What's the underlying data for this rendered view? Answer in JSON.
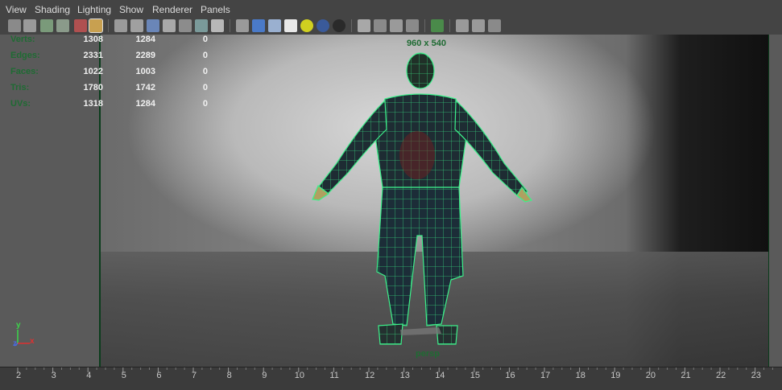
{
  "menu": [
    "View",
    "Shading",
    "Lighting",
    "Show",
    "Renderer",
    "Panels"
  ],
  "hud": {
    "rows": [
      {
        "label": "Verts:",
        "a": "1308",
        "b": "1284",
        "c": "0"
      },
      {
        "label": "Edges:",
        "a": "2331",
        "b": "2289",
        "c": "0"
      },
      {
        "label": "Faces:",
        "a": "1022",
        "b": "1003",
        "c": "0"
      },
      {
        "label": "Tris:",
        "a": "1780",
        "b": "1742",
        "c": "0"
      },
      {
        "label": "UVs:",
        "a": "1318",
        "b": "1284",
        "c": "0"
      }
    ],
    "resolution": "960 x 540",
    "camera": "persp"
  },
  "axis": {
    "y": "y",
    "x": "x",
    "z": "z"
  },
  "timeline": {
    "numbers": [
      "2",
      "3",
      "4",
      "5",
      "6",
      "7",
      "8",
      "9",
      "10",
      "11",
      "12",
      "13",
      "14",
      "15",
      "16",
      "17",
      "18",
      "19",
      "20",
      "21",
      "22",
      "23"
    ]
  },
  "colors": {
    "hud_label": "#1f6b33",
    "hud_value": "#f0f0f0",
    "wireframe": "#3df08a",
    "background": "#444444"
  },
  "icons": {
    "toolbar": [
      "select-camera-icon",
      "camera-attributes-icon",
      "bookmarks-icon",
      "image-plane-icon",
      "2d-pan-zoom-icon",
      "grease-pencil-icon",
      "grid-icon",
      "film-gate-icon",
      "resolution-gate-icon",
      "gate-mask-icon",
      "field-chart-icon",
      "safe-action-icon",
      "safe-title-icon",
      "wireframe-icon",
      "smooth-shade-icon",
      "wireframe-on-shaded-icon",
      "textured-icon",
      "use-all-lights-icon",
      "shadows-icon",
      "ambient-occlusion-icon",
      "motion-blur-icon",
      "anti-alias-icon",
      "depth-of-field-icon",
      "isolate-select-icon",
      "xray-icon",
      "xray-active-icon",
      "xray-joints-icon"
    ]
  }
}
